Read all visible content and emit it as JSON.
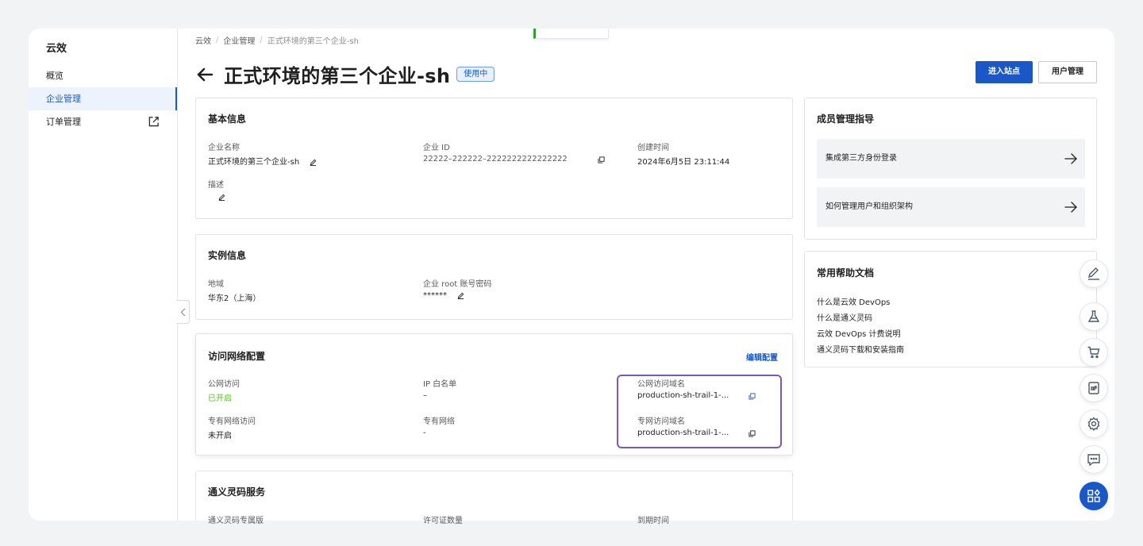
{
  "sidebar": {
    "title": "云效",
    "items": [
      {
        "label": "概览"
      },
      {
        "label": "企业管理"
      },
      {
        "label": "订单管理"
      }
    ]
  },
  "breadcrumb": [
    "云效",
    "企业管理",
    "正式环境的第三个企业-sh"
  ],
  "header": {
    "title": "正式环境的第三个企业-sh",
    "status_badge": "使用中",
    "primary_button": "进入站点",
    "secondary_button": "用户管理"
  },
  "basic_info": {
    "title": "基本信息",
    "name_label": "企业名称",
    "name_value": "正式环境的第三个企业-sh",
    "id_label": "企业 ID",
    "id_value": "22222–222222–2222222222222222",
    "created_label": "创建时间",
    "created_value": "2024年6月5日 23:11:44",
    "desc_label": "描述"
  },
  "instance_info": {
    "title": "实例信息",
    "region_label": "地域",
    "region_value": "华东2（上海）",
    "root_label": "企业 root 账号密码",
    "root_value": "******"
  },
  "network": {
    "title": "访问网络配置",
    "edit_link": "编辑配置",
    "public_label": "公网访问",
    "public_value": "已开启",
    "ip_label": "IP 白名单",
    "ip_value": "–",
    "public_domain_label": "公网访问域名",
    "public_domain_value": "production-sh-trail-1-...",
    "vpc_access_label": "专有网络访问",
    "vpc_access_value": "未开启",
    "vpc_label": "专有网络",
    "vpc_value": "-",
    "vpc_domain_label": "专网访问域名",
    "vpc_domain_value": "production-sh-trail-1-..."
  },
  "lingma": {
    "title": "通义灵码服务",
    "col1_label": "通义灵码专属版",
    "col2_label": "许可证数量",
    "col3_label": "到期时间"
  },
  "member_guide": {
    "title": "成员管理指导",
    "items": [
      "集成第三方身份登录",
      "如何管理用户和组织架构"
    ]
  },
  "help_docs": {
    "title": "常用帮助文档",
    "links": [
      "什么是云效 DevOps",
      "什么是通义灵码",
      "云效 DevOps 计费说明",
      "通义灵码下载和安装指南"
    ]
  },
  "colors": {
    "accent": "#1b58c7",
    "highlight": "#7b56c8",
    "success": "#52c41a"
  },
  "floating_tools": [
    "edit-icon",
    "flask-icon",
    "cart-icon",
    "api-icon",
    "gear-icon",
    "feedback-icon",
    "apps-icon"
  ]
}
